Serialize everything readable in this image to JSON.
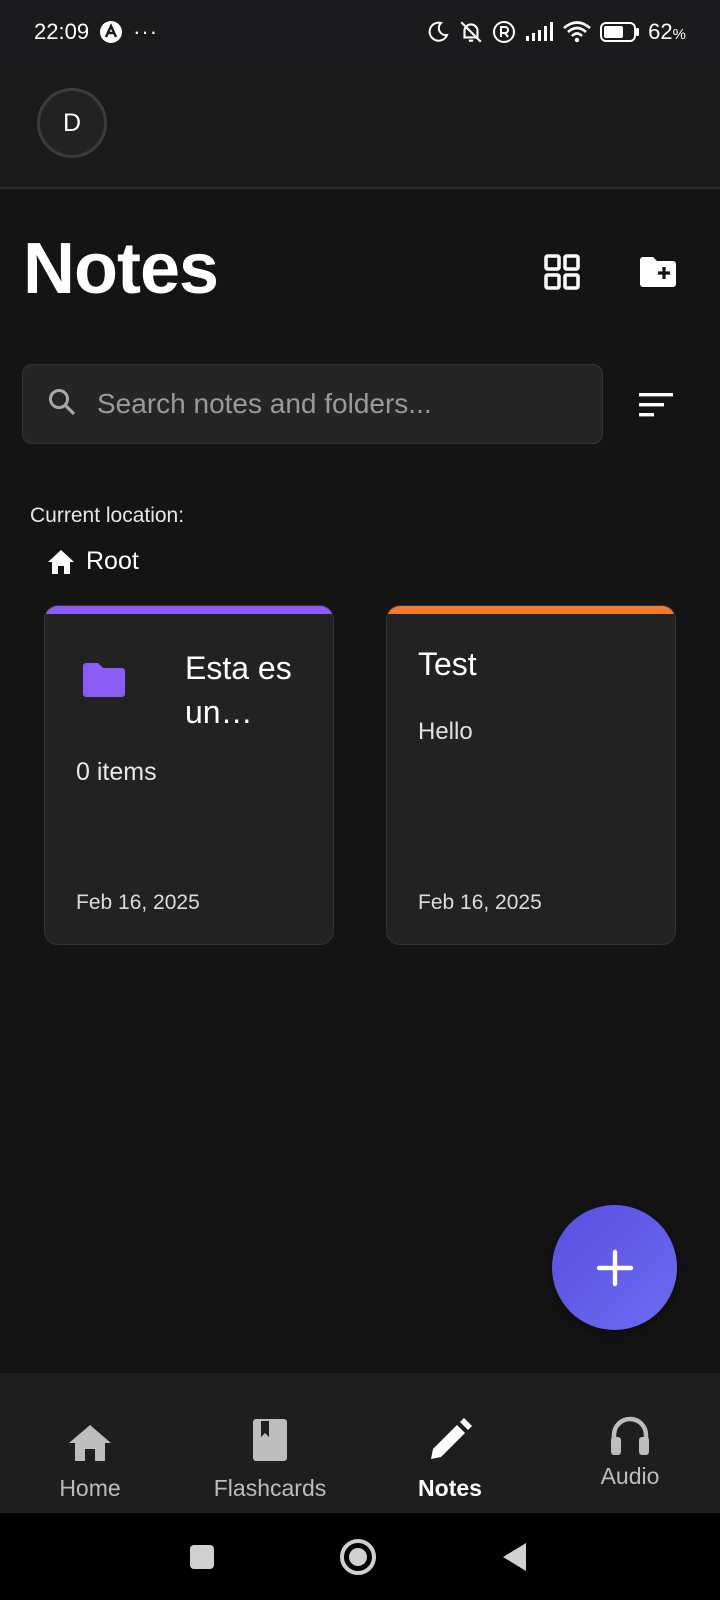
{
  "status_bar": {
    "time": "22:09",
    "battery": "62",
    "battery_unit": "%",
    "more": "···"
  },
  "header": {
    "avatar_initial": "D"
  },
  "page": {
    "title": "Notes"
  },
  "search": {
    "placeholder": "Search notes and folders...",
    "value": ""
  },
  "location": {
    "label": "Current location:",
    "breadcrumb": "Root"
  },
  "items": {
    "folder": {
      "title": "Esta es un…",
      "count": "0 items",
      "date": "Feb 16, 2025",
      "accent": "#8b5cf6",
      "icon": "folder-icon"
    },
    "note": {
      "title": "Test",
      "body": "Hello",
      "date": "Feb 16, 2025",
      "accent": "#f07c2a"
    }
  },
  "bottom_nav": {
    "items": [
      {
        "label": "Home",
        "icon": "home-icon"
      },
      {
        "label": "Flashcards",
        "icon": "book-icon"
      },
      {
        "label": "Notes",
        "icon": "pencil-icon",
        "active": true
      },
      {
        "label": "Audio",
        "icon": "headphones-icon"
      }
    ]
  },
  "colors": {
    "background": "#141414",
    "fab_gradient_start": "#5a4fe0",
    "fab_gradient_end": "#6a6cf2"
  }
}
